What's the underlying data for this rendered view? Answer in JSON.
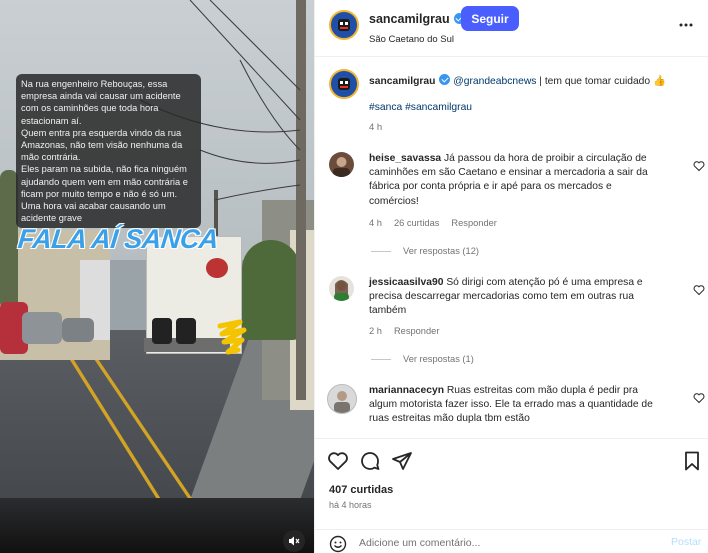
{
  "media": {
    "caption_lines": [
      "Na rua engenheiro Rebouças, essa empresa ainda vai causar um acidente com os caminhões que toda hora estacionam aí.",
      "Quem entra pra esquerda vindo da rua Amazonas, não tem visão nenhuma da mão contrária.",
      "Eles param na subida, não fica ninguém ajudando quem vem em mão contrária e ficam por muito tempo e não é só um.",
      "Uma hora vai acabar causando um acidente grave"
    ],
    "brand_text": "FALA AÍ SANCA",
    "mute_icon": "speaker-muted-icon"
  },
  "header": {
    "username": "sancamilgrau",
    "separator": "•",
    "follow_label": "Seguir",
    "location": "São Caetano do Sul",
    "more_icon": "more-horizontal-icon",
    "accent_color": "#4a5dff"
  },
  "caption": {
    "username": "sancamilgrau",
    "mention": "@grandeabcnews",
    "text": " | tem que tomar cuidado 👍",
    "hashtags": "#sanca #sancamilgrau",
    "time": "4 h"
  },
  "comments": [
    {
      "username": "heise_savassa",
      "text": "Já passou da hora de proibir a circulação de caminhões em são Caetano e ensinar a mercadoria a sair da fábrica por conta própria e ir apé para os mercados e comércios!",
      "time": "4 h",
      "likes": "26 curtidas",
      "reply": "Responder",
      "view_replies": "Ver respostas (12)"
    },
    {
      "username": "jessicaasilva90",
      "text": "Só dirigi com atenção pó é uma empresa e precisa descarregar mercadorias como tem em outras rua também",
      "time": "2 h",
      "reply": "Responder",
      "view_replies": "Ver respostas (1)"
    },
    {
      "username": "mariannacecyn",
      "text": "Ruas estreitas com mão dupla é pedir pra algum motorista fazer isso. Ele ta errado mas a quantidade de ruas estreitas mão dupla tbm estão"
    }
  ],
  "actions": {
    "likes": "407 curtidas",
    "time_ago": "há 4 horas"
  },
  "add_comment": {
    "placeholder": "Adicione um comentário...",
    "post_label": "Postar"
  }
}
